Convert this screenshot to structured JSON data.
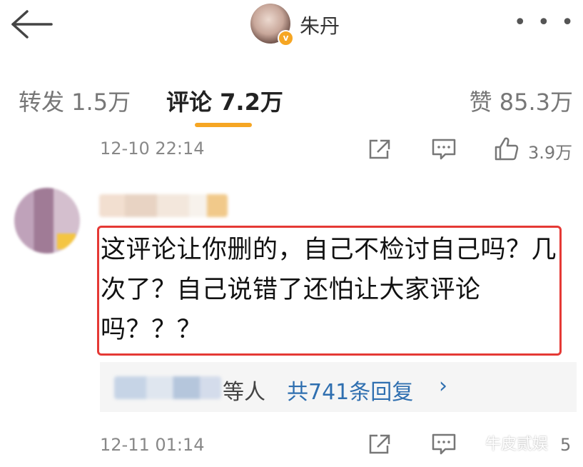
{
  "header": {
    "user_name": "朱丹",
    "more_label": "• • •",
    "verified_badge": "v"
  },
  "tabs": {
    "repost": "转发 1.5万",
    "comment": "评论 7.2万",
    "like": "赞 85.3万"
  },
  "post_meta": {
    "time": "12-10 22:14",
    "like_count": "3.9万"
  },
  "comment": {
    "text": "这评论让你删的，自己不检讨自己吗？几次了？自己说错了还怕让大家评论吗？？？",
    "replies": {
      "etc_label": "等人",
      "count_label": "共741条回复",
      "chevron": "›"
    },
    "time": "12-11 01:14",
    "like_count": "5"
  },
  "watermark": "牛皮贰娱",
  "colors": {
    "accent": "#f6a623",
    "highlight_border": "#e53935",
    "link": "#2f6fb0"
  },
  "icons": [
    "back-arrow-icon",
    "share-icon",
    "comment-icon",
    "thumb-up-icon",
    "verified-icon"
  ]
}
